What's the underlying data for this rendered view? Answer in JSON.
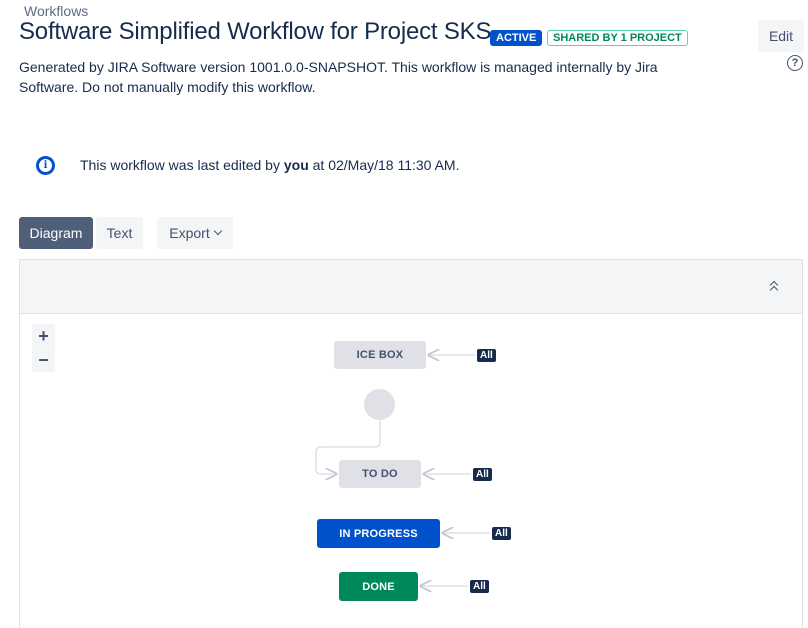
{
  "breadcrumb": "Workflows",
  "title": "Software Simplified Workflow for Project SKS",
  "badges": {
    "active": "ACTIVE",
    "shared": "SHARED BY 1 PROJECT"
  },
  "header": {
    "edit_label": "Edit",
    "help_icon": "?"
  },
  "description": "Generated by JIRA Software version 1001.0.0-SNAPSHOT. This workflow is managed internally by Jira Software. Do not manually modify this workflow.",
  "info": {
    "prefix": "This workflow was last edited by ",
    "user": "you",
    "suffix": " at 02/May/18 11:30 AM.",
    "icon": "info-icon"
  },
  "view_tabs": {
    "diagram": "Diagram",
    "text": "Text",
    "export": "Export"
  },
  "zoom": {
    "in": "+",
    "out": "−"
  },
  "diagram": {
    "statuses": [
      {
        "label": "ICE BOX",
        "category": "todo"
      },
      {
        "label": "TO DO",
        "category": "todo"
      },
      {
        "label": "IN PROGRESS",
        "category": "in-progress"
      },
      {
        "label": "DONE",
        "category": "done"
      }
    ],
    "transition_label": "All",
    "colors": {
      "todo": "#dfe1e6",
      "in_progress": "#0052cc",
      "done": "#00875a",
      "global_transition": "#172b4d"
    }
  },
  "colors": {
    "active_badge": "#0052cc",
    "shared_badge": "#00875a",
    "selected_tab": "#505f79"
  }
}
